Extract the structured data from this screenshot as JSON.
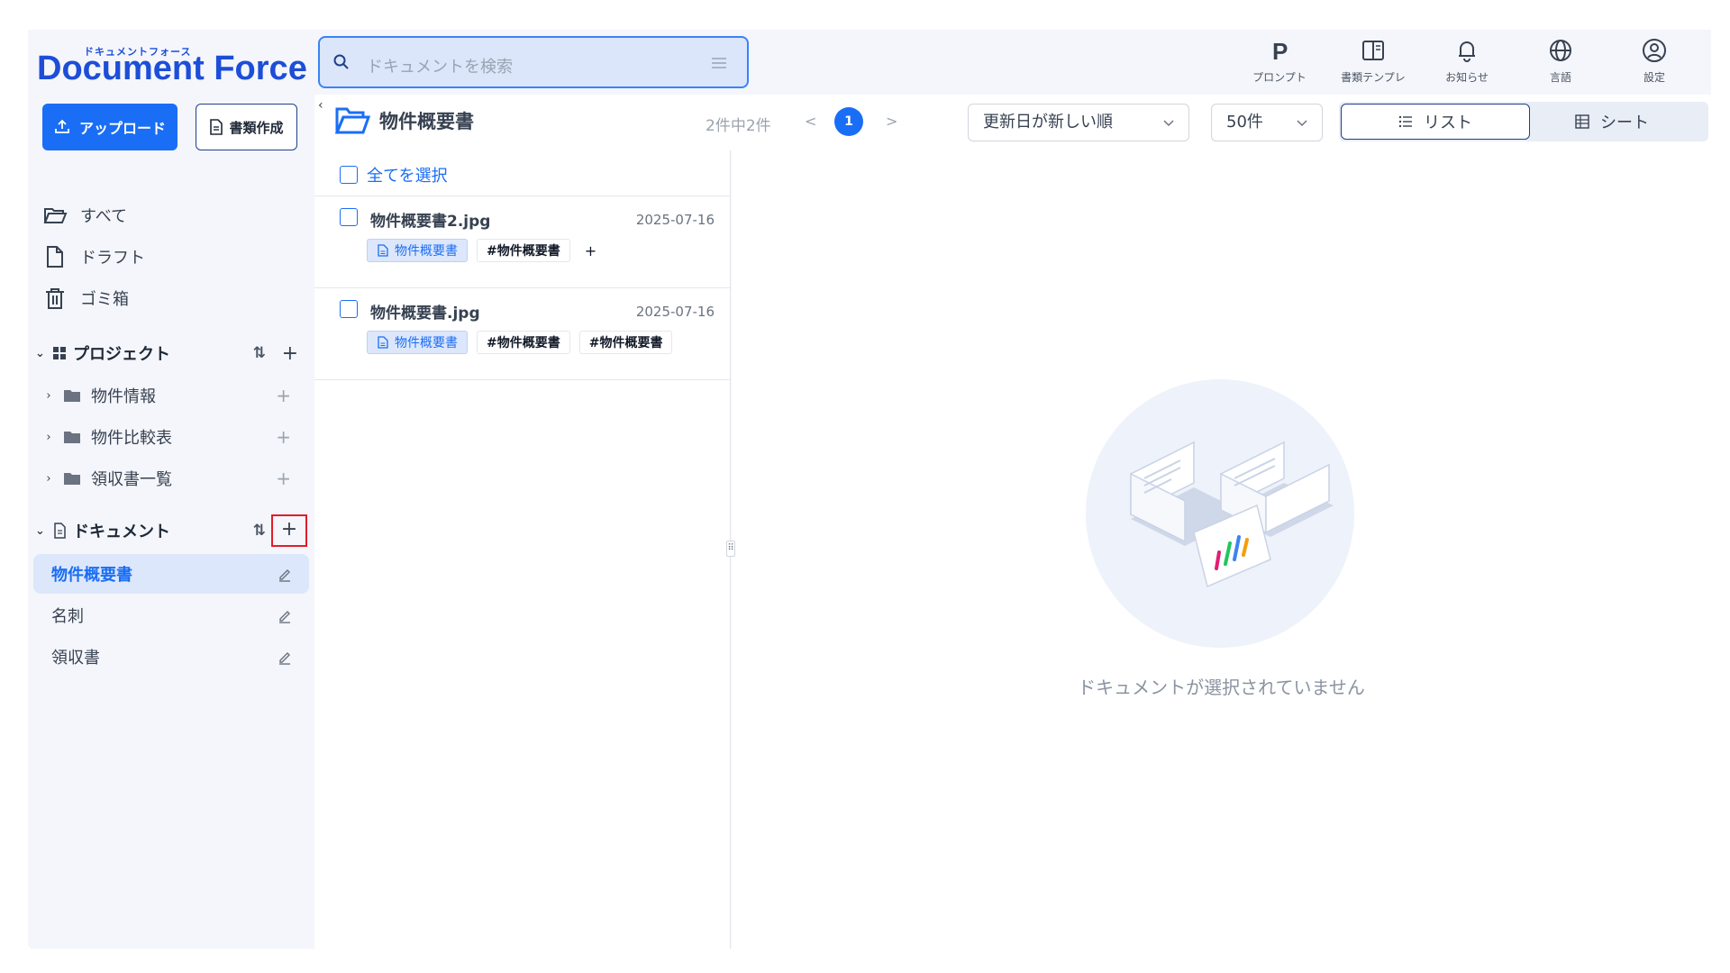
{
  "app": {
    "logo_kana": "ドキュメントフォース",
    "logo_text": "Document Force"
  },
  "search": {
    "placeholder": "ドキュメントを検索"
  },
  "header_buttons": [
    {
      "icon": "prompt-p-icon",
      "label": "プロンプト"
    },
    {
      "icon": "template-book-icon",
      "label": "書類テンプレ"
    },
    {
      "icon": "bell-icon",
      "label": "お知らせ"
    },
    {
      "icon": "globe-icon",
      "label": "言語"
    },
    {
      "icon": "user-circle-icon",
      "label": "設定"
    }
  ],
  "sidebar": {
    "upload_label": "アップロード",
    "create_label": "書類作成",
    "nav": [
      {
        "icon": "folder-open-icon",
        "label": "すべて"
      },
      {
        "icon": "file-icon",
        "label": "ドラフト"
      },
      {
        "icon": "trash-icon",
        "label": "ゴミ箱"
      }
    ],
    "projects_title": "プロジェクト",
    "projects": [
      {
        "label": "物件情報"
      },
      {
        "label": "物件比較表"
      },
      {
        "label": "領収書一覧"
      }
    ],
    "documents_title": "ドキュメント",
    "documents": [
      {
        "label": "物件概要書",
        "active": true
      },
      {
        "label": "名刺",
        "active": false
      },
      {
        "label": "領収書",
        "active": false
      }
    ],
    "sort_symbol": "⇅",
    "add_symbol": "+"
  },
  "toolbar": {
    "folder_title": "物件概要書",
    "count_text": "2件中2件",
    "prev": "<",
    "current_page": "1",
    "next": ">",
    "sort_value": "更新日が新しい順",
    "per_page_value": "50件",
    "view_list_label": "リスト",
    "view_sheet_label": "シート",
    "active_view": "list"
  },
  "list": {
    "select_all_label": "全てを選択",
    "items": [
      {
        "filename": "物件概要書2.jpg",
        "date": "2025-07-16",
        "type_tag": "物件概要書",
        "tags": [
          "#物件概要書"
        ],
        "add_tag": "+"
      },
      {
        "filename": "物件概要書.jpg",
        "date": "2025-07-16",
        "type_tag": "物件概要書",
        "tags": [
          "#物件概要書",
          "#物件概要書"
        ]
      }
    ]
  },
  "preview": {
    "empty_message": "ドキュメントが選択されていません"
  },
  "colors": {
    "accent": "#1a6ef5",
    "highlight_box": "#e11d2b",
    "sidebar_bg": "#f4f6fb"
  }
}
